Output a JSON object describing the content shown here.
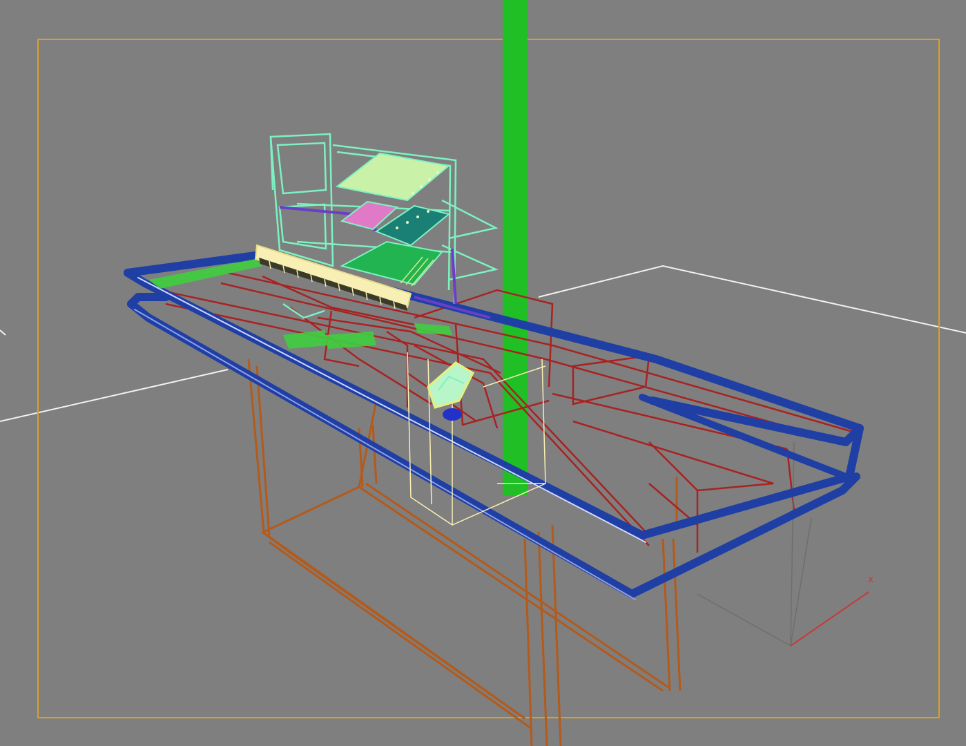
{
  "viewport": {
    "background_color": "#7f7f7f",
    "safe_frame_color": "#d7a12a",
    "grid_color": "#f2f2f2",
    "axis_tripod_label": "x"
  },
  "colors": {
    "vertical_pole": "#1fbf25",
    "counter_rail": "#1f3fa5",
    "counter_frame": "#a82222",
    "counter_legs": "#b45a1a",
    "display_rack": "#7cf2c2",
    "display_panel": "#8fd98f",
    "panel_pink": "#e17ac6",
    "panel_teal": "#1a7f74",
    "panel_green": "#22b451",
    "sign_cream": "#f8efb5",
    "terminal_yellow": "#e6f080",
    "terminal_blue": "#2232c8",
    "tripod_line": "#c43a3a"
  },
  "icons": [
    "viewport-grid",
    "safe-frame",
    "checkout-counter-wireframe",
    "display-rack-wireframe",
    "payment-terminal-wireframe",
    "vertical-pole",
    "axis-tripod-icon"
  ]
}
